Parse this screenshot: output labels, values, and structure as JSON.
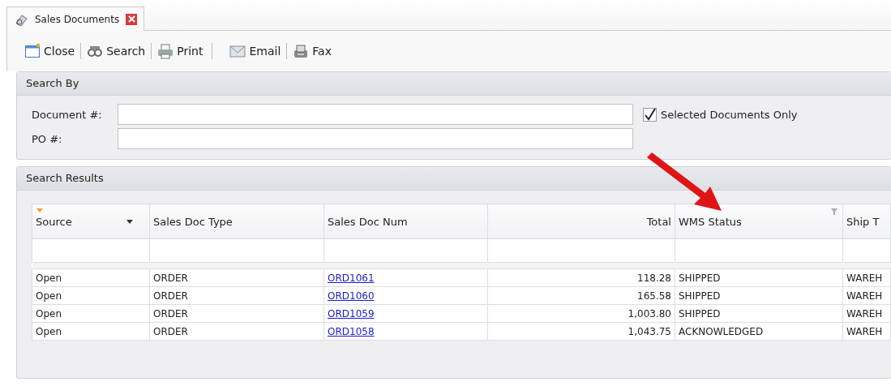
{
  "tab": {
    "title": "Sales Documents",
    "selected": true
  },
  "toolbar": [
    {
      "label": "Close"
    },
    {
      "label": "Search"
    },
    {
      "label": "Print"
    },
    {
      "label": "Email"
    },
    {
      "label": "Fax"
    }
  ],
  "search_by": {
    "title": "Search By",
    "fields": [
      {
        "label": "Document #:"
      },
      {
        "label": "PO #:"
      }
    ],
    "selected_only": {
      "label": "Selected Documents Only",
      "checked": true
    }
  },
  "results": {
    "title": "Search Results",
    "columns": [
      {
        "label": "Source",
        "kind": "text",
        "dropdown": true,
        "filter": false
      },
      {
        "label": "Sales Doc Type",
        "kind": "text",
        "dropdown": false,
        "filter": false
      },
      {
        "label": "Sales Doc Num",
        "kind": "link",
        "dropdown": false,
        "filter": false
      },
      {
        "label": "Total",
        "kind": "number",
        "dropdown": false,
        "filter": false
      },
      {
        "label": "WMS Status",
        "kind": "text",
        "dropdown": false,
        "filter": true
      },
      {
        "label": "Ship T",
        "kind": "text",
        "dropdown": false,
        "filter": false
      }
    ],
    "rows": [
      [
        "Open",
        "ORDER",
        "ORD1061",
        "118.28",
        "SHIPPED",
        "WAREH"
      ],
      [
        "Open",
        "ORDER",
        "ORD1060",
        "165.58",
        "SHIPPED",
        "WAREH"
      ],
      [
        "Open",
        "ORDER",
        "ORD1059",
        "1,003.80",
        "SHIPPED",
        "WAREH"
      ],
      [
        "Open",
        "ORDER",
        "ORD1058",
        "1,043.75",
        "ACKNOWLEDGED",
        "WAREH"
      ]
    ]
  }
}
